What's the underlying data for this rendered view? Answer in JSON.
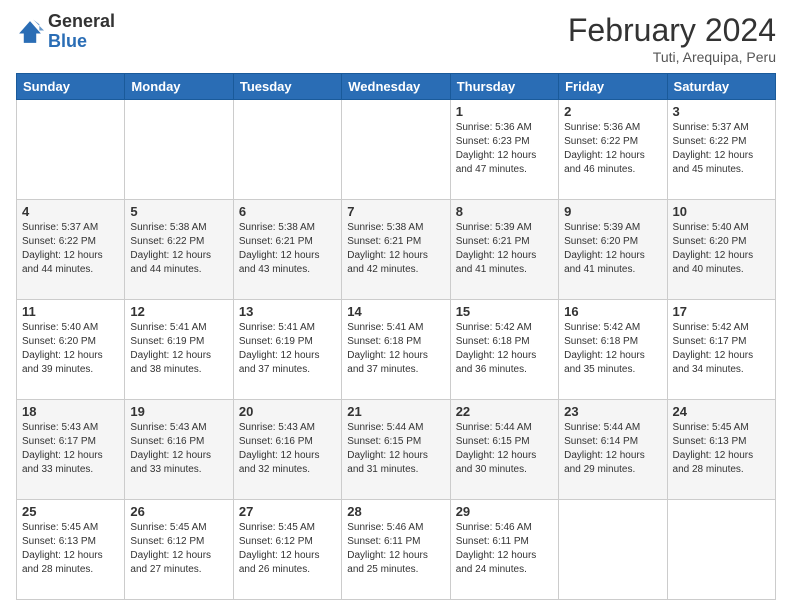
{
  "header": {
    "logo_general": "General",
    "logo_blue": "Blue",
    "month_year": "February 2024",
    "location": "Tuti, Arequipa, Peru"
  },
  "days_of_week": [
    "Sunday",
    "Monday",
    "Tuesday",
    "Wednesday",
    "Thursday",
    "Friday",
    "Saturday"
  ],
  "weeks": [
    [
      {
        "day": "",
        "info": ""
      },
      {
        "day": "",
        "info": ""
      },
      {
        "day": "",
        "info": ""
      },
      {
        "day": "",
        "info": ""
      },
      {
        "day": "1",
        "info": "Sunrise: 5:36 AM\nSunset: 6:23 PM\nDaylight: 12 hours\nand 47 minutes."
      },
      {
        "day": "2",
        "info": "Sunrise: 5:36 AM\nSunset: 6:22 PM\nDaylight: 12 hours\nand 46 minutes."
      },
      {
        "day": "3",
        "info": "Sunrise: 5:37 AM\nSunset: 6:22 PM\nDaylight: 12 hours\nand 45 minutes."
      }
    ],
    [
      {
        "day": "4",
        "info": "Sunrise: 5:37 AM\nSunset: 6:22 PM\nDaylight: 12 hours\nand 44 minutes."
      },
      {
        "day": "5",
        "info": "Sunrise: 5:38 AM\nSunset: 6:22 PM\nDaylight: 12 hours\nand 44 minutes."
      },
      {
        "day": "6",
        "info": "Sunrise: 5:38 AM\nSunset: 6:21 PM\nDaylight: 12 hours\nand 43 minutes."
      },
      {
        "day": "7",
        "info": "Sunrise: 5:38 AM\nSunset: 6:21 PM\nDaylight: 12 hours\nand 42 minutes."
      },
      {
        "day": "8",
        "info": "Sunrise: 5:39 AM\nSunset: 6:21 PM\nDaylight: 12 hours\nand 41 minutes."
      },
      {
        "day": "9",
        "info": "Sunrise: 5:39 AM\nSunset: 6:20 PM\nDaylight: 12 hours\nand 41 minutes."
      },
      {
        "day": "10",
        "info": "Sunrise: 5:40 AM\nSunset: 6:20 PM\nDaylight: 12 hours\nand 40 minutes."
      }
    ],
    [
      {
        "day": "11",
        "info": "Sunrise: 5:40 AM\nSunset: 6:20 PM\nDaylight: 12 hours\nand 39 minutes."
      },
      {
        "day": "12",
        "info": "Sunrise: 5:41 AM\nSunset: 6:19 PM\nDaylight: 12 hours\nand 38 minutes."
      },
      {
        "day": "13",
        "info": "Sunrise: 5:41 AM\nSunset: 6:19 PM\nDaylight: 12 hours\nand 37 minutes."
      },
      {
        "day": "14",
        "info": "Sunrise: 5:41 AM\nSunset: 6:18 PM\nDaylight: 12 hours\nand 37 minutes."
      },
      {
        "day": "15",
        "info": "Sunrise: 5:42 AM\nSunset: 6:18 PM\nDaylight: 12 hours\nand 36 minutes."
      },
      {
        "day": "16",
        "info": "Sunrise: 5:42 AM\nSunset: 6:18 PM\nDaylight: 12 hours\nand 35 minutes."
      },
      {
        "day": "17",
        "info": "Sunrise: 5:42 AM\nSunset: 6:17 PM\nDaylight: 12 hours\nand 34 minutes."
      }
    ],
    [
      {
        "day": "18",
        "info": "Sunrise: 5:43 AM\nSunset: 6:17 PM\nDaylight: 12 hours\nand 33 minutes."
      },
      {
        "day": "19",
        "info": "Sunrise: 5:43 AM\nSunset: 6:16 PM\nDaylight: 12 hours\nand 33 minutes."
      },
      {
        "day": "20",
        "info": "Sunrise: 5:43 AM\nSunset: 6:16 PM\nDaylight: 12 hours\nand 32 minutes."
      },
      {
        "day": "21",
        "info": "Sunrise: 5:44 AM\nSunset: 6:15 PM\nDaylight: 12 hours\nand 31 minutes."
      },
      {
        "day": "22",
        "info": "Sunrise: 5:44 AM\nSunset: 6:15 PM\nDaylight: 12 hours\nand 30 minutes."
      },
      {
        "day": "23",
        "info": "Sunrise: 5:44 AM\nSunset: 6:14 PM\nDaylight: 12 hours\nand 29 minutes."
      },
      {
        "day": "24",
        "info": "Sunrise: 5:45 AM\nSunset: 6:13 PM\nDaylight: 12 hours\nand 28 minutes."
      }
    ],
    [
      {
        "day": "25",
        "info": "Sunrise: 5:45 AM\nSunset: 6:13 PM\nDaylight: 12 hours\nand 28 minutes."
      },
      {
        "day": "26",
        "info": "Sunrise: 5:45 AM\nSunset: 6:12 PM\nDaylight: 12 hours\nand 27 minutes."
      },
      {
        "day": "27",
        "info": "Sunrise: 5:45 AM\nSunset: 6:12 PM\nDaylight: 12 hours\nand 26 minutes."
      },
      {
        "day": "28",
        "info": "Sunrise: 5:46 AM\nSunset: 6:11 PM\nDaylight: 12 hours\nand 25 minutes."
      },
      {
        "day": "29",
        "info": "Sunrise: 5:46 AM\nSunset: 6:11 PM\nDaylight: 12 hours\nand 24 minutes."
      },
      {
        "day": "",
        "info": ""
      },
      {
        "day": "",
        "info": ""
      }
    ]
  ]
}
